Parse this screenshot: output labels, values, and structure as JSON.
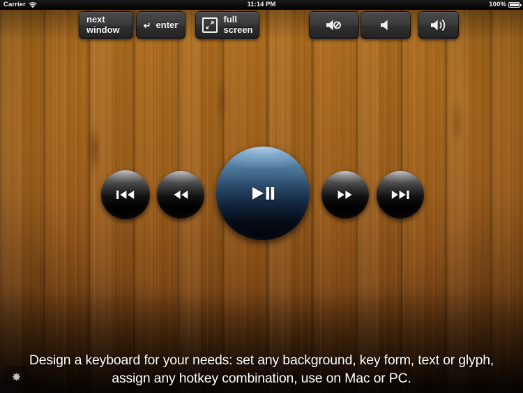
{
  "status_bar": {
    "carrier": "Carrier",
    "wifi_icon": "wifi-icon",
    "time": "11:14 PM",
    "battery_percent": "100%",
    "battery_icon": "battery-icon"
  },
  "hotkeys": [
    {
      "id": "next-window",
      "label": "next\nwindow",
      "icon": null
    },
    {
      "id": "enter",
      "label": "enter",
      "icon": "return-arrow-icon",
      "glyph": "↵"
    },
    {
      "id": "full-screen",
      "label": "full\nscreen",
      "icon": "expand-fullscreen-icon"
    },
    {
      "id": "mute",
      "label": "",
      "icon": "speaker-mute-icon"
    },
    {
      "id": "volume-down",
      "label": "",
      "icon": "speaker-low-icon"
    },
    {
      "id": "volume-up",
      "label": "",
      "icon": "speaker-high-icon"
    }
  ],
  "transport": [
    {
      "id": "previous-track",
      "icon": "previous-track-icon",
      "style": "black"
    },
    {
      "id": "rewind",
      "icon": "rewind-icon",
      "style": "black"
    },
    {
      "id": "play-pause",
      "icon": "play-pause-icon",
      "style": "blue"
    },
    {
      "id": "fast-forward",
      "icon": "fast-forward-icon",
      "style": "black"
    },
    {
      "id": "next-track",
      "icon": "next-track-icon",
      "style": "black"
    }
  ],
  "caption": {
    "line1": "Design a keyboard for your needs: set any background, key form, text or glyph,",
    "line2": "assign any hotkey combination, use on Mac or PC.",
    "full": "Design a keyboard for your needs: set any background, key form, text or glyph, assign any hotkey combination, use on Mac or PC."
  },
  "settings": {
    "icon": "gear-icon",
    "label": ""
  },
  "colors": {
    "wood_light": "#b0701f",
    "wood_mid": "#9d5f1d",
    "wood_dark": "#24120a",
    "key_face": "#3b3b3b",
    "play_blue": "#4b7495",
    "caption_text": "#ffffff",
    "status_bar_bg": "#000000"
  }
}
